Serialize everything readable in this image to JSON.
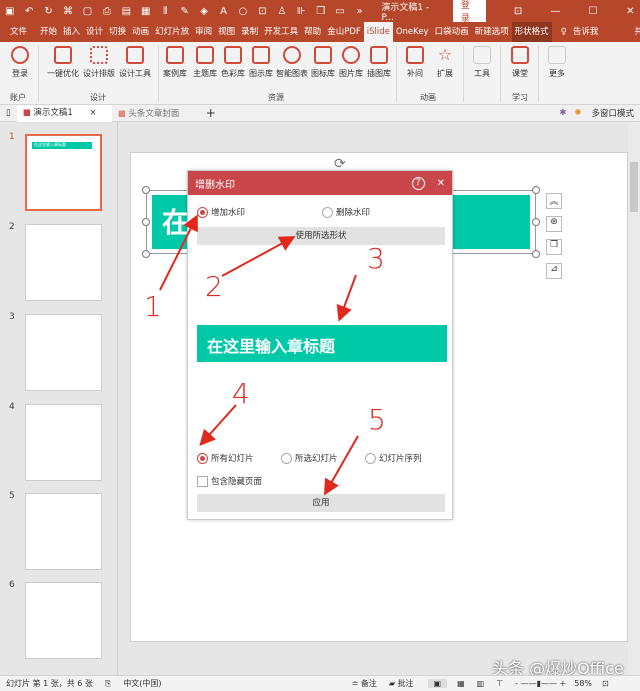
{
  "titlebar": {
    "doc_title": "演示文稿1 - P...",
    "login": "登录"
  },
  "tabs": [
    "文件",
    "开始",
    "插入",
    "设计",
    "切换",
    "动画",
    "幻灯片放",
    "审阅",
    "视图",
    "录制",
    "开发工具",
    "帮助",
    "金山PDF",
    "iSlide",
    "OneKey",
    "口袋动画",
    "新建选项",
    "形状格式",
    "告诉我",
    "共享"
  ],
  "ribbon": {
    "buttons": [
      "登录",
      "一键优化",
      "设计排版",
      "设计工具",
      "案例库",
      "主题库",
      "色彩库",
      "图示库",
      "智能图表",
      "图标库",
      "图片库",
      "插图库",
      "补间",
      "扩展",
      "工具",
      "课堂",
      "更多"
    ],
    "groups": [
      "账户",
      "设计",
      "资源",
      "动画",
      "学习"
    ]
  },
  "doctabs": {
    "tab1": "演示文稿1",
    "tab2": "头条文章封面",
    "multiwindow": "多窗口模式"
  },
  "thumbs": {
    "numbers": [
      "1",
      "2",
      "3",
      "4",
      "5",
      "6"
    ],
    "slide1_title": "在这里输入章标题"
  },
  "slide": {
    "title_char": "在"
  },
  "dialog": {
    "title": "增删水印",
    "add": "增加水印",
    "remove": "删除水印",
    "use_shape": "使用所选形状",
    "preview": "在这里输入章标题",
    "all": "所有幻灯片",
    "selected": "所选幻灯片",
    "sequence": "幻灯片序列",
    "hidden": "包含隐藏页面",
    "apply": "应用"
  },
  "annotations": [
    "1",
    "2",
    "3",
    "4",
    "5"
  ],
  "status": {
    "slide_info": "幻灯片 第 1 张，共 6 张",
    "lang": "中文(中国)",
    "notes": "备注",
    "comments": "批注",
    "zoom": "58%"
  },
  "watermark": "头条 @爆炒Office",
  "colors": {
    "accent": "#b7472a",
    "teal": "#00c9a7",
    "dialog": "#c9474a",
    "arrow": "#e0281e"
  }
}
